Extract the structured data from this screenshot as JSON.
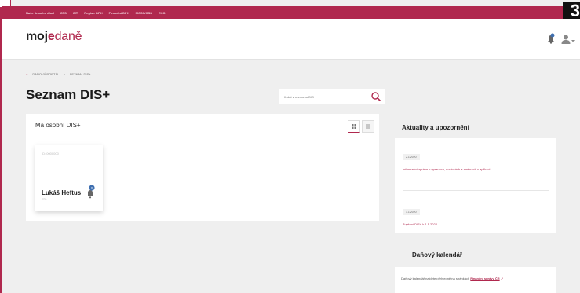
{
  "topbar": {
    "links": [
      "Naše finanční úřad",
      "CFS",
      "CIT",
      "Registr DPH",
      "Finanční DPH",
      "MOSS/OSS",
      "EKO"
    ],
    "step_badge": "3"
  },
  "header": {
    "logo_part1": "moj",
    "logo_part2": "e",
    "logo_part3": "daně"
  },
  "breadcrumb": {
    "items": [
      "DAŇOVÝ PORTÁL",
      "SEZNAM DIS+"
    ]
  },
  "page": {
    "title": "Seznam DIS+"
  },
  "search": {
    "placeholder": "Hledat v seznamu DIS"
  },
  "main_panel": {
    "title": "Má osobní DIS+",
    "card": {
      "id_label": "ID: 0000000",
      "name": "Lukáš Heftus",
      "sub": "DIS+",
      "notification_count": "0"
    }
  },
  "news": {
    "title": "Aktuality a upozornění",
    "items": [
      {
        "date": "2.1.2020",
        "text": "Informační zpráva o úpravách, novinkách a změnách v aplikaci"
      },
      {
        "date": "1.1.2020",
        "text": "Zvýšení DIS+ k 1.1.2022"
      }
    ]
  },
  "calendar": {
    "title": "Daňový kalendář",
    "text": "Daňový kalendář najdete přehledně na stránkách",
    "link": "Finanční správy ČR"
  },
  "colors": {
    "accent": "#b0284e",
    "page_background": "#efefef"
  }
}
